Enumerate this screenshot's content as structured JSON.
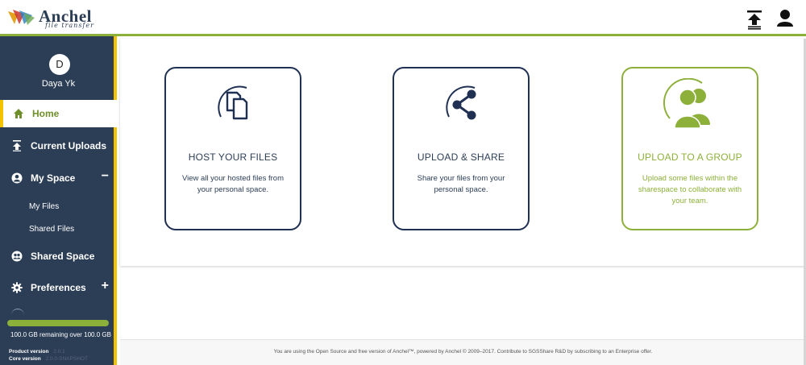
{
  "header": {
    "logo_brand": "Anchel",
    "logo_tagline": "file transfer",
    "upload_icon": "upload-icon",
    "user_icon": "user-icon"
  },
  "sidebar": {
    "avatar_letter": "D",
    "username": "Daya Yk",
    "items": [
      {
        "label": "Home",
        "icon": "home-icon",
        "active": true
      },
      {
        "label": "Current Uploads",
        "icon": "upload-icon"
      },
      {
        "label": "My Space",
        "icon": "user-circle-icon",
        "toggle": "−"
      },
      {
        "label": "Shared Space",
        "icon": "group-icon"
      },
      {
        "label": "Preferences",
        "icon": "gear-icon",
        "toggle": "+"
      }
    ],
    "sub_items": [
      {
        "label": "My Files"
      },
      {
        "label": "Shared Files"
      }
    ],
    "storage_text": "100.0 GB remaining over 100.0 GB",
    "storage_used_fraction": 0.0,
    "product_version_label": "Product version",
    "product_version_value": "2.0.1",
    "core_version_label": "Core version",
    "core_version_value": "2.0.0-SNAPSHOT"
  },
  "cards": [
    {
      "title": "HOST YOUR FILES",
      "desc": "View all your hosted files from your personal space.",
      "icon": "files-icon"
    },
    {
      "title": "UPLOAD & SHARE",
      "desc": "Share your files from your personal space.",
      "icon": "share-icon"
    },
    {
      "title": "UPLOAD TO A GROUP",
      "desc": "Upload some files within the sharespace to collaborate with your team.",
      "icon": "group-icon"
    }
  ],
  "footer": {
    "text": "You are using the Open Source and free version of Anchel™, powered by Anchel © 2009–2017. Contribute to SGSShare R&D by subscribing to an Enterprise offer."
  },
  "colors": {
    "sidebar_bg": "#2c3e56",
    "accent_green": "#8db03a",
    "accent_yellow": "#f3c300",
    "navy": "#1f3052"
  }
}
